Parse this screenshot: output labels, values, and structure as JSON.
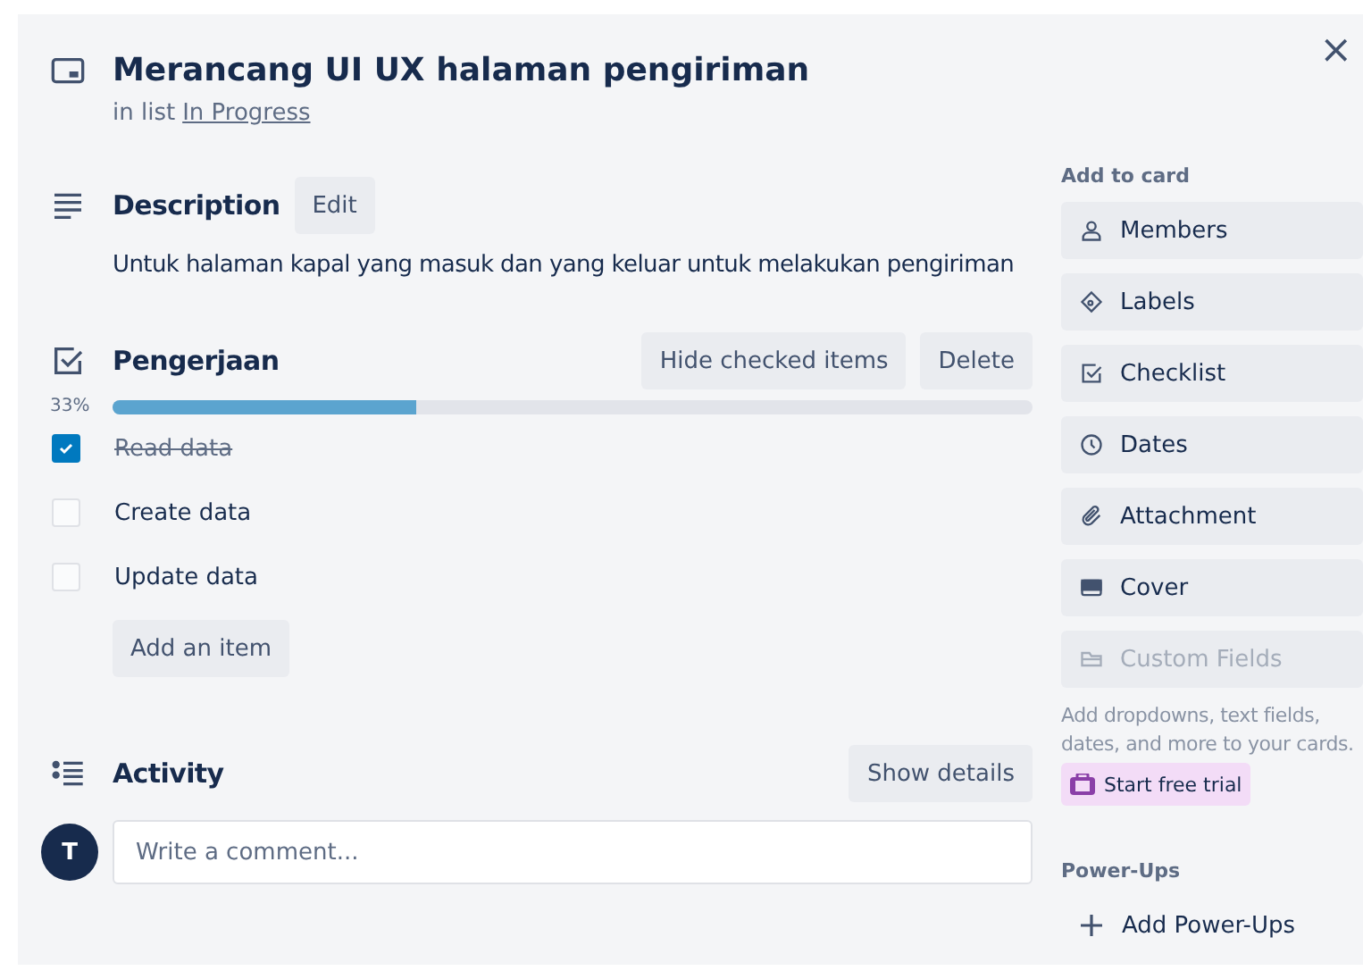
{
  "card": {
    "title": "Merancang UI UX halaman pengiriman",
    "list_prefix": "in list",
    "list_name": "In Progress",
    "close": "×"
  },
  "description": {
    "heading": "Description",
    "edit": "Edit",
    "text": "Untuk halaman kapal yang masuk dan yang keluar untuk melakukan pengiriman"
  },
  "checklist": {
    "heading": "Pengerjaan",
    "hide_button": "Hide checked items",
    "delete_button": "Delete",
    "percent": "33%",
    "level": 0.33,
    "items": [
      {
        "label": "Read data",
        "checked": true
      },
      {
        "label": "Create data",
        "checked": false
      },
      {
        "label": "Update data",
        "checked": false
      }
    ],
    "add_button": "Add an item"
  },
  "activity": {
    "heading": "Activity",
    "details_button": "Show details",
    "avatar": "T",
    "comment_placeholder": "Write a comment..."
  },
  "sidebar": {
    "add_heading": "Add to card",
    "actions": [
      {
        "kind": "members",
        "label": "Members",
        "disabled": false
      },
      {
        "kind": "labels",
        "label": "Labels",
        "disabled": false
      },
      {
        "kind": "checklist",
        "label": "Checklist",
        "disabled": false
      },
      {
        "kind": "dates",
        "label": "Dates",
        "disabled": false
      },
      {
        "kind": "attachment",
        "label": "Attachment",
        "disabled": false
      },
      {
        "kind": "cover",
        "label": "Cover",
        "disabled": false
      },
      {
        "kind": "fields",
        "label": "Custom Fields",
        "disabled": true
      }
    ],
    "upsell": "Add dropdowns, text fields, dates, and more to your cards.",
    "trial_button": "Start free trial",
    "powerups_heading": "Power-Ups",
    "add_powerups": "Add Power-Ups"
  }
}
